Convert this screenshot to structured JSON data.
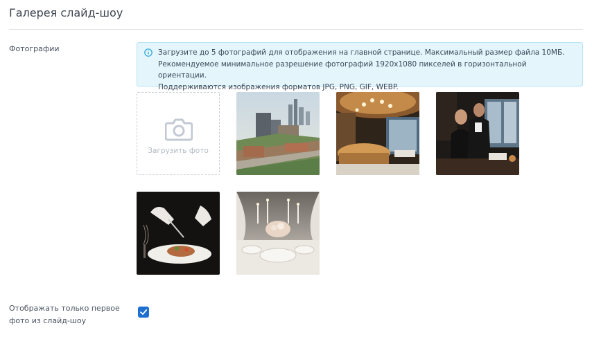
{
  "section": {
    "title": "Галерея слайд-шоу"
  },
  "photos_field": {
    "label": "Фотографии",
    "info": [
      "Загрузите до 5 фотографий для отображения на главной странице. Максимальный размер файла 10МБ.",
      "Рекомендуемое минимальное разрешение фотографий 1920х1080 пикселей в горизонтальной ориентации.",
      "Поддерживаются изображения форматов JPG, PNG, GIF, WEBP."
    ],
    "upload_label": "Загрузить фото",
    "thumbnails": [
      {
        "icon": "city-buildings-photo"
      },
      {
        "icon": "restaurant-interior-photo"
      },
      {
        "icon": "waiters-photo"
      },
      {
        "icon": "plated-dish-photo"
      },
      {
        "icon": "table-setting-photo"
      }
    ]
  },
  "first_only_field": {
    "label_line1": "Отображать только первое",
    "label_line2": "фото из слайд-шоу",
    "checked": true
  },
  "colors": {
    "accent": "#1e6fd0",
    "info_bg": "#e4f5fc",
    "info_border": "#b5e3f3",
    "info_icon": "#29a6d8"
  }
}
